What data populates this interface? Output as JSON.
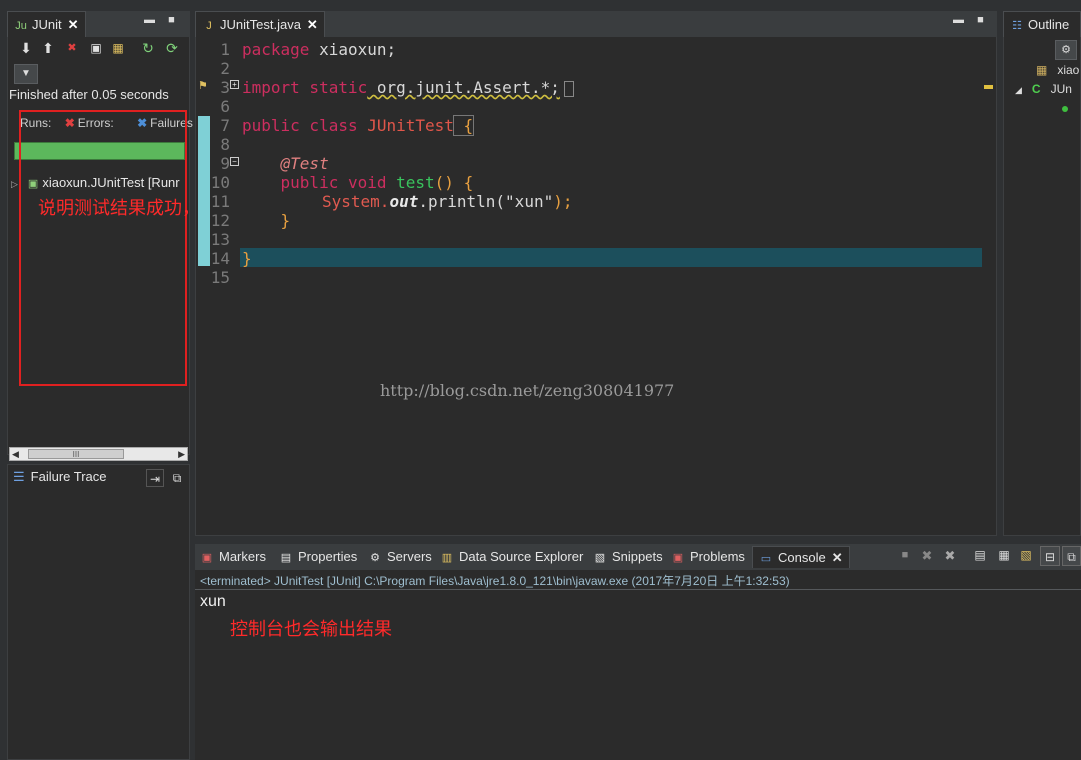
{
  "junit": {
    "tab_label": "JUnit",
    "status": "Finished after 0.05 seconds",
    "runs_label": "Runs:",
    "errors_label": "Errors:",
    "failures_label": "Failures",
    "tree_item": "xiaoxun.JUnitTest [Runr",
    "annotation": "说明测试结果成功，代码正确",
    "failure_trace_label": "Failure Trace",
    "scroll_mark": "III",
    "status_color": "#5cb85c"
  },
  "editor": {
    "tab_label": "JUnitTest.java",
    "lines": [
      {
        "n": "1",
        "html_key": "l1"
      },
      {
        "n": "2"
      },
      {
        "n": "3"
      },
      {
        "n": "6"
      },
      {
        "n": "7"
      },
      {
        "n": "8"
      },
      {
        "n": "9"
      },
      {
        "n": "10"
      },
      {
        "n": "11"
      },
      {
        "n": "12"
      },
      {
        "n": "13"
      },
      {
        "n": "14"
      },
      {
        "n": "15"
      }
    ],
    "code": {
      "pkg_kw": "package",
      "pkg_name": " xiaoxun;",
      "import_kw": "import static",
      "import_path": " org.junit.Assert.*;",
      "public_kw": "public class",
      "class_name": " JUnitTest",
      "open_brace": " {",
      "at_test": "@Test",
      "method_kw": "public void",
      "method_name": " test",
      "method_sig": "() {",
      "sys": "System.",
      "out": "out",
      "println": ".println(",
      "arg": "\"xun\"",
      "end_call": ");",
      "close_inner": "}",
      "close_outer": "}"
    },
    "watermark": "http://blog.csdn.net/zeng308041977"
  },
  "outline": {
    "tab_label": "Outline",
    "item1": "xiao",
    "item2": "JUn"
  },
  "console": {
    "tabs": [
      "Markers",
      "Properties",
      "Servers",
      "Data Source Explorer",
      "Snippets",
      "Problems",
      "Console"
    ],
    "status": "<terminated> JUnitTest [JUnit] C:\\Program Files\\Java\\jre1.8.0_121\\bin\\javaw.exe (2017年7月20日 上午1:32:53)",
    "output": "xun",
    "annotation": "控制台也会输出结果"
  }
}
